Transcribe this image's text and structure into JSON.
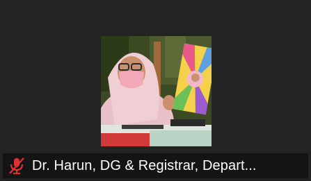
{
  "participant": {
    "display_name": "Dr. Harun, DG & Registrar, Depart...",
    "mic_state": "muted",
    "mic_icon": "mic-muted-icon",
    "mic_icon_color": "#e02f2f"
  },
  "colors": {
    "tile_background": "#232323",
    "namebar_background": "#141414",
    "name_text": "#ffffff"
  }
}
